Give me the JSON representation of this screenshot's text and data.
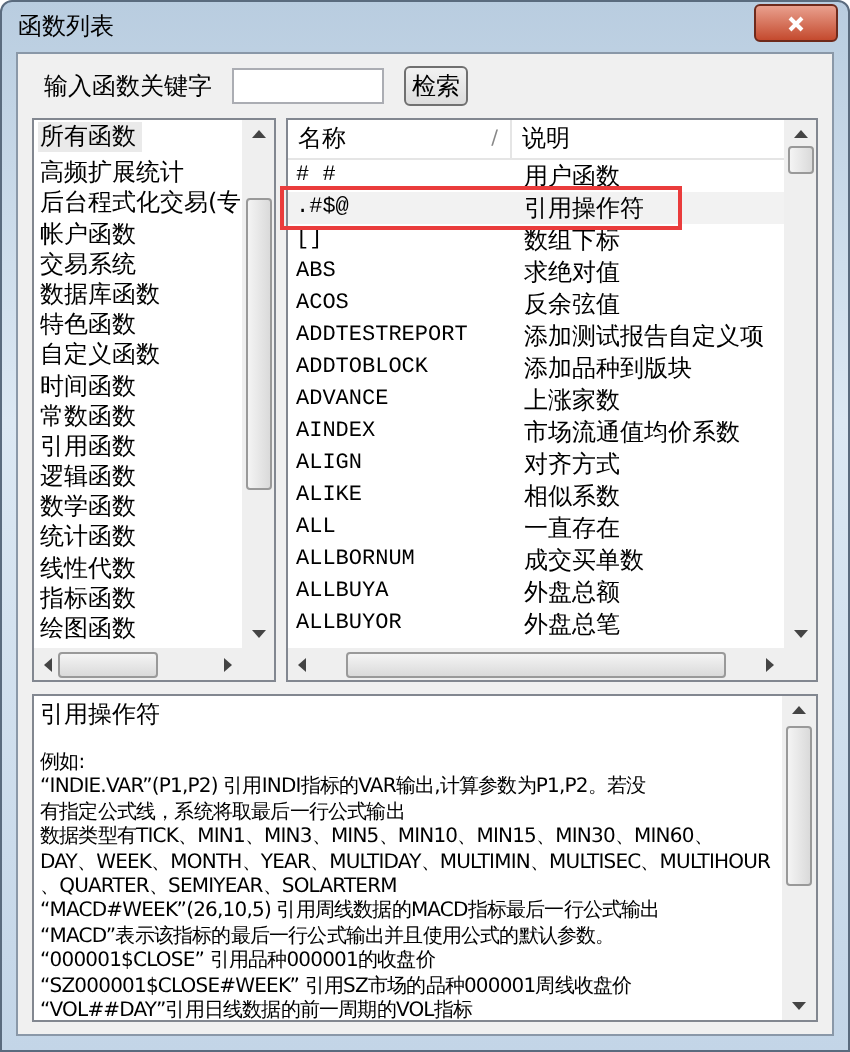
{
  "window": {
    "title": "函数列表"
  },
  "search": {
    "label": "输入函数关键字",
    "button": "检索"
  },
  "categories": [
    {
      "label": "所有函数",
      "selected": true
    },
    {
      "label": "高频扩展统计",
      "selected": false
    },
    {
      "label": "后台程式化交易(专",
      "selected": false
    },
    {
      "label": "帐户函数",
      "selected": false
    },
    {
      "label": "交易系统",
      "selected": false
    },
    {
      "label": "数据库函数",
      "selected": false
    },
    {
      "label": "特色函数",
      "selected": false
    },
    {
      "label": "自定义函数",
      "selected": false
    },
    {
      "label": "时间函数",
      "selected": false
    },
    {
      "label": "常数函数",
      "selected": false
    },
    {
      "label": "引用函数",
      "selected": false
    },
    {
      "label": "逻辑函数",
      "selected": false
    },
    {
      "label": "数学函数",
      "selected": false
    },
    {
      "label": "统计函数",
      "selected": false
    },
    {
      "label": "线性代数",
      "selected": false
    },
    {
      "label": "指标函数",
      "selected": false
    },
    {
      "label": "绘图函数",
      "selected": false
    }
  ],
  "table": {
    "columns": [
      "名称",
      "说明"
    ],
    "sort_mark": "/",
    "rows": [
      {
        "name": "# #",
        "desc": "用户函数",
        "selected": false,
        "highlighted": false
      },
      {
        "name": ".#$@",
        "desc": "引用操作符",
        "selected": true,
        "highlighted": true
      },
      {
        "name": "[]",
        "desc": "数组下标",
        "selected": false,
        "highlighted": false
      },
      {
        "name": "ABS",
        "desc": "求绝对值",
        "selected": false,
        "highlighted": false
      },
      {
        "name": "ACOS",
        "desc": "反余弦值",
        "selected": false,
        "highlighted": false
      },
      {
        "name": "ADDTESTREPORT",
        "desc": "添加测试报告自定义项",
        "selected": false,
        "highlighted": false
      },
      {
        "name": "ADDTOBLOCK",
        "desc": "添加品种到版块",
        "selected": false,
        "highlighted": false
      },
      {
        "name": "ADVANCE",
        "desc": "上涨家数",
        "selected": false,
        "highlighted": false
      },
      {
        "name": "AINDEX",
        "desc": "市场流通值均价系数",
        "selected": false,
        "highlighted": false
      },
      {
        "name": "ALIGN",
        "desc": "对齐方式",
        "selected": false,
        "highlighted": false
      },
      {
        "name": "ALIKE",
        "desc": "相似系数",
        "selected": false,
        "highlighted": false
      },
      {
        "name": "ALL",
        "desc": "一直存在",
        "selected": false,
        "highlighted": false
      },
      {
        "name": "ALLBORNUM",
        "desc": "成交买单数",
        "selected": false,
        "highlighted": false
      },
      {
        "name": "ALLBUYA",
        "desc": "外盘总额",
        "selected": false,
        "highlighted": false
      },
      {
        "name": "ALLBUYOR",
        "desc": "外盘总笔",
        "selected": false,
        "highlighted": false
      }
    ]
  },
  "detail": {
    "title": "引用操作符",
    "lines": [
      "例如:",
      "“INDIE.VAR”(P1,P2) 引用INDI指标的VAR输出,计算参数为P1,P2。若没",
      "有指定公式线，系统将取最后一行公式输出",
      "数据类型有TICK、MIN1、MIN3、MIN5、MIN10、MIN15、MIN30、MIN60、",
      "DAY、WEEK、MONTH、YEAR、MULTIDAY、MULTIMIN、MULTISEC、MULTIHOUR",
      "、QUARTER、SEMIYEAR、SOLARTERM",
      "“MACD#WEEK”(26,10,5) 引用周线数据的MACD指标最后一行公式输出",
      "“MACD”表示该指标的最后一行公式输出并且使用公式的默认参数。",
      "“000001$CLOSE” 引用品种000001的收盘价",
      "“SZ000001$CLOSE#WEEK” 引用SZ市场的品种000001周线收盘价",
      "“VOL##DAY”引用日线数据的前一周期的VOL指标"
    ]
  }
}
